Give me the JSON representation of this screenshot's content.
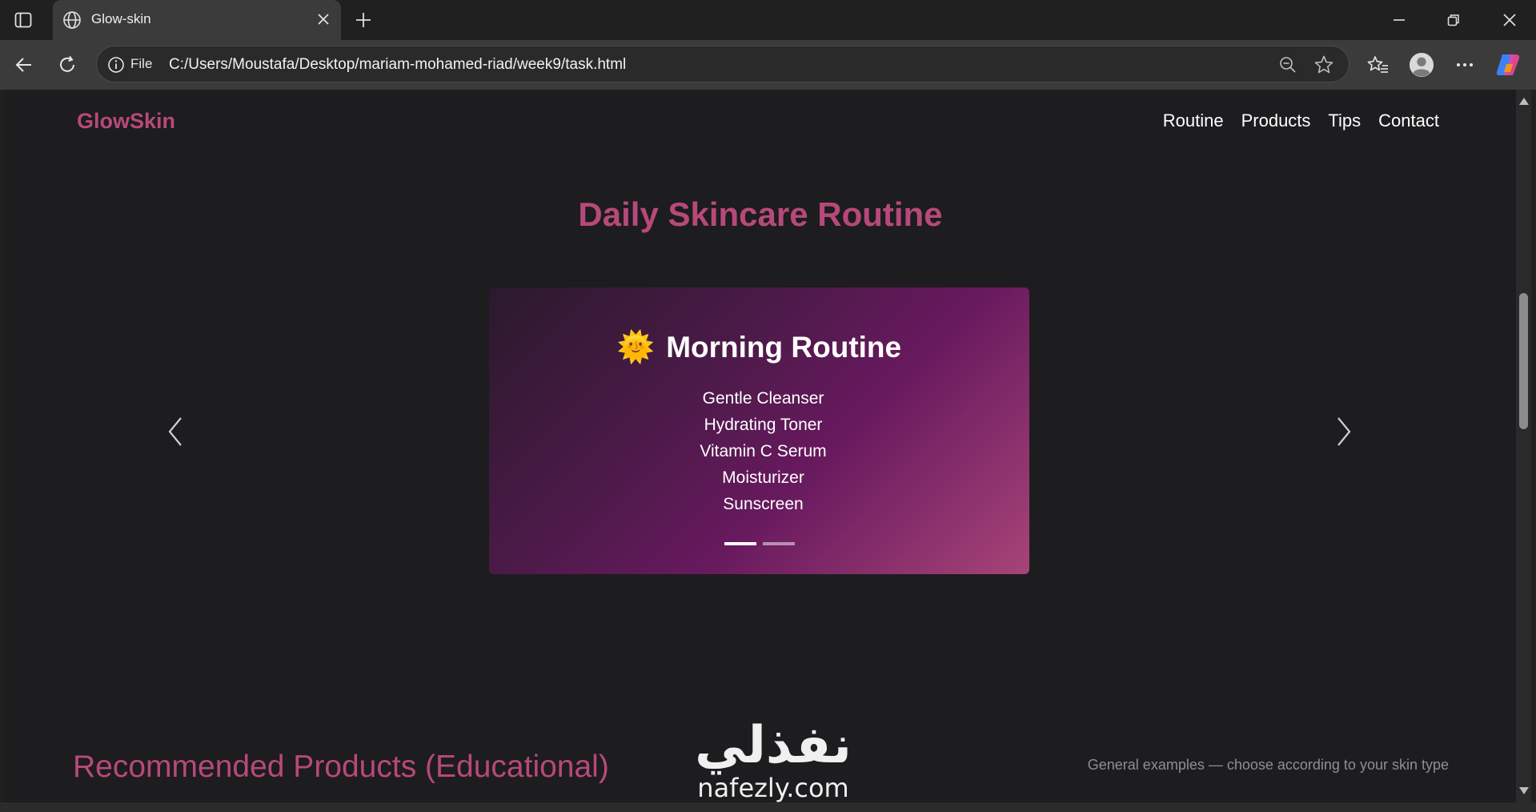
{
  "browser": {
    "tab_title": "Glow-skin",
    "address": {
      "scheme_label": "File",
      "url": "C:/Users/Moustafa/Desktop/mariam-mohamed-riad/week9/task.html"
    }
  },
  "site": {
    "brand": "GlowSkin",
    "nav": [
      "Routine",
      "Products",
      "Tips",
      "Contact"
    ],
    "hero_title": "Daily Skincare Routine",
    "carousel": {
      "current_slide": 1,
      "slide_count": 2,
      "slide": {
        "emoji": "🌞",
        "title": "Morning Routine",
        "steps": [
          "Gentle Cleanser",
          "Hydrating Toner",
          "Vitamin C Serum",
          "Moisturizer",
          "Sunscreen"
        ]
      }
    },
    "products_section": {
      "title": "Recommended Products (Educational)",
      "note": "General examples — choose according to your skin type"
    },
    "accent_color": "#b7497a"
  },
  "watermark": {
    "arabic": "نفذلي",
    "latin": "nafezly.com"
  }
}
